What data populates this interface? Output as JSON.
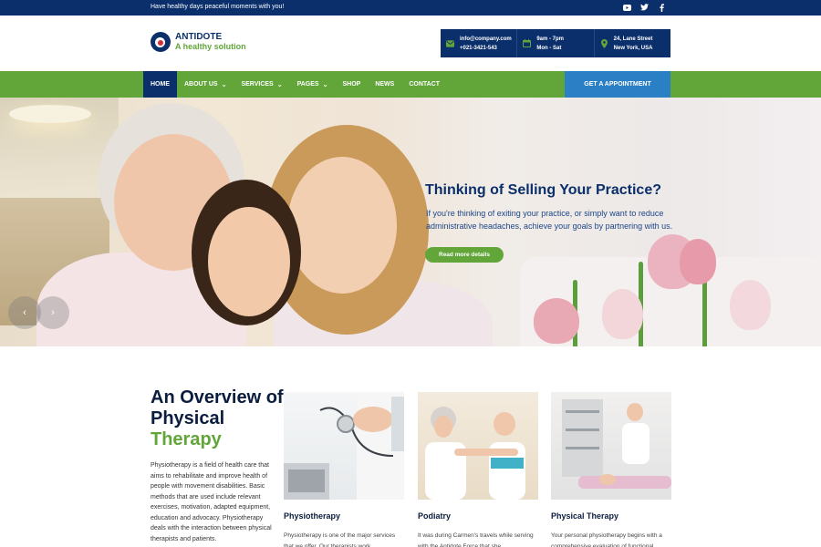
{
  "topbar": {
    "tagline": "Have healthy days peaceful moments with you!",
    "social": [
      "youtube-icon",
      "twitter-icon",
      "facebook-icon"
    ]
  },
  "brand": {
    "name": "ANTIDOTE",
    "tagline": "A healthy solution",
    "colors": {
      "navy": "#0b2f6b",
      "green": "#62a63a",
      "blue": "#2b7fc4"
    }
  },
  "contact": [
    {
      "icon": "mail-icon",
      "line1": "info@company.com",
      "line2": "+021-3421-543"
    },
    {
      "icon": "calendar-icon",
      "line1": "9am - 7pm",
      "line2": "Mon - Sat"
    },
    {
      "icon": "map-pin-icon",
      "line1": "24, Lane Street",
      "line2": "New York, USA"
    }
  ],
  "nav": {
    "items": [
      {
        "label": "HOME",
        "active": true,
        "dropdown": false
      },
      {
        "label": "ABOUT US",
        "active": false,
        "dropdown": true
      },
      {
        "label": "SERVICES",
        "active": false,
        "dropdown": true
      },
      {
        "label": "PAGES",
        "active": false,
        "dropdown": true
      },
      {
        "label": "SHOP",
        "active": false,
        "dropdown": false
      },
      {
        "label": "NEWS",
        "active": false,
        "dropdown": false
      },
      {
        "label": "CONTACT",
        "active": false,
        "dropdown": false
      }
    ],
    "cta": "GET A APPOINTMENT"
  },
  "hero": {
    "title": "Thinking of Selling Your Practice?",
    "subtitle": "If you're thinking of exiting your practice, or simply want to reduce administrative headaches, achieve your goals by partnering with us.",
    "button": "Read more details"
  },
  "overview": {
    "heading_line1": "An Overview of",
    "heading_line2": "Physical",
    "heading_line3": "Therapy",
    "text": "Physiotherapy is a field of health care that aims to rehabilitate and improve health of people with movement disabilities. Basic methods that are used include relevant exercises, motivation, adapted equipment, education and advocacy. Physiotherapy deals with the interaction between physical therapists and patients.",
    "cards": [
      {
        "title": "Physiotherapy",
        "desc": "Physiotherapy is one of the major services that we offer. Our therapists work"
      },
      {
        "title": "Podiatry",
        "desc": "It was during Carmen's travels while serving with the Antidote Force that she"
      },
      {
        "title": "Physical Therapy",
        "desc": "Your personal physiotherapy begins with a comprehensive evaluation of functional"
      }
    ]
  }
}
